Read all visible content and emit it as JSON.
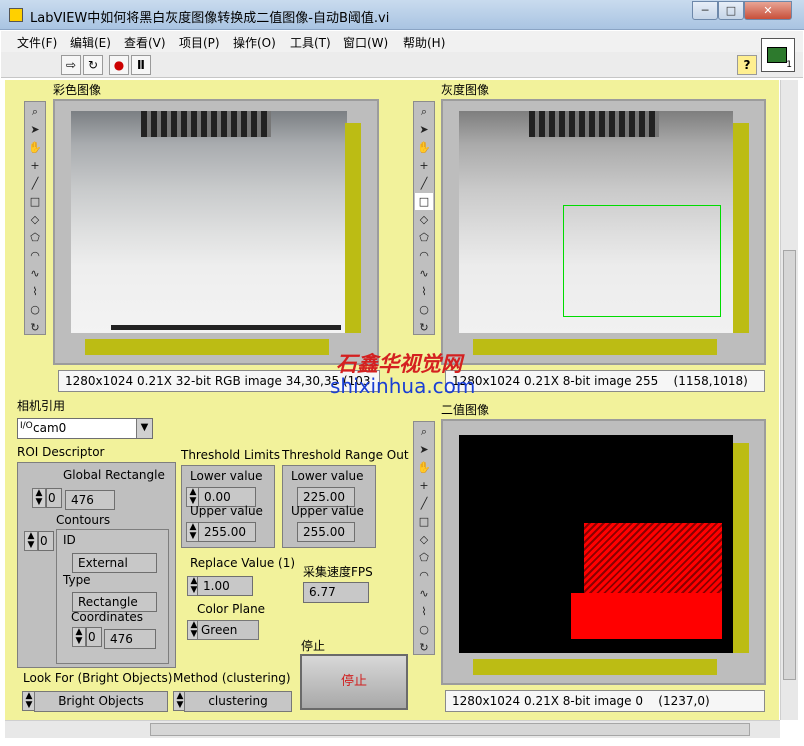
{
  "window": {
    "title": "LabVIEW中如何将黑白灰度图像转换成二值图像-自动B阈值.vi",
    "min_label": "─",
    "max_label": "□",
    "close_label": "✕"
  },
  "menu": [
    "文件(F)",
    "编辑(E)",
    "查看(V)",
    "项目(P)",
    "操作(O)",
    "工具(T)",
    "窗口(W)",
    "帮助(H)"
  ],
  "toolbar": {
    "run": "⇨",
    "run_cont": "↻",
    "abort": "●",
    "pause": "Ⅱ",
    "help": "?",
    "vi_icon_number": "1"
  },
  "color_image": {
    "label": "彩色图像",
    "status": "1280x1024 0.21X 32-bit RGB image 34,30,35",
    "status_tail": "(103",
    "watermark_cn": "石鑫华视觉网",
    "watermark_url": "shixinhua.com"
  },
  "gray_image": {
    "label": "灰度图像",
    "status": "1280x1024 0.21X 8-bit image 255",
    "coords": "(1158,1018)"
  },
  "binary_image": {
    "label": "二值图像",
    "status": "1280x1024 0.21X 8-bit image 0",
    "coords": "(1237,0)"
  },
  "camera": {
    "label": "相机引用",
    "prefix": "I/O",
    "value": "cam0"
  },
  "roi": {
    "label": "ROI Descriptor",
    "global_rect_label": "Global Rectangle",
    "global_index": "0",
    "global_value": "476",
    "contours_label": "Contours",
    "contours_index": "0",
    "id_label": "ID",
    "id_value": "External",
    "type_label": "Type",
    "type_value": "Rectangle",
    "coords_label": "Coordinates",
    "coords_index": "0",
    "coords_value": "476"
  },
  "threshold_limits": {
    "label": "Threshold Limits",
    "lower_label": "Lower value",
    "lower": "0.00",
    "upper_label": "Upper value",
    "upper": "255.00"
  },
  "threshold_range_out": {
    "label": "Threshold Range Out",
    "lower_label": "Lower value",
    "lower": "225.00",
    "upper_label": "Upper value",
    "upper": "255.00"
  },
  "replace_value": {
    "label": "Replace Value (1)",
    "value": "1.00"
  },
  "fps": {
    "label": "采集速度FPS",
    "value": "6.77"
  },
  "color_plane": {
    "label": "Color Plane",
    "value": "Green"
  },
  "stop": {
    "label": "停止",
    "button": "停止"
  },
  "look_for": {
    "label": "Look For (Bright Objects)",
    "value": "Bright Objects"
  },
  "method": {
    "label": "Method (clustering)",
    "value": "clustering"
  },
  "palette_icons": [
    "zoom-icon",
    "pointer-icon",
    "pan-icon",
    "point-icon",
    "line-icon",
    "rectangle-icon",
    "rotated-rect-icon",
    "polygon-icon",
    "annulus-icon",
    "freehand-icon",
    "broken-line-icon",
    "oval-icon",
    "rotate-icon"
  ]
}
